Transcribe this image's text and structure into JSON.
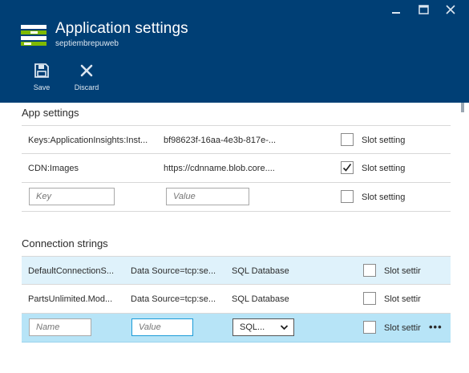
{
  "window": {
    "title": "Application settings",
    "subtitle": "septiembrepuweb",
    "controls": [
      "minimize-icon",
      "maximize-icon",
      "close-icon"
    ]
  },
  "toolbar": {
    "save_label": "Save",
    "discard_label": "Discard"
  },
  "app_settings": {
    "title": "App settings",
    "rows": [
      {
        "key": "Keys:ApplicationInsights:Inst...",
        "value": "bf98623f-16aa-4e3b-817e-...",
        "slot_label": "Slot setting",
        "checked": false
      },
      {
        "key": "CDN:Images",
        "value": "https://cdnname.blob.core....",
        "slot_label": "Slot setting",
        "checked": true
      }
    ],
    "new_row": {
      "key_placeholder": "Key",
      "value_placeholder": "Value",
      "slot_label": "Slot setting",
      "checked": false
    }
  },
  "connection_strings": {
    "title": "Connection strings",
    "rows": [
      {
        "name": "DefaultConnectionS...",
        "value": "Data Source=tcp:se...",
        "type": "SQL Database",
        "slot_label": "Slot settir",
        "checked": false
      },
      {
        "name": "PartsUnlimited.Mod...",
        "value": "Data Source=tcp:se...",
        "type": "SQL Database",
        "slot_label": "Slot settir",
        "checked": false
      }
    ],
    "new_row": {
      "name_placeholder": "Name",
      "value_placeholder": "Value",
      "type_selected": "SQL...",
      "slot_label": "Slot settir",
      "checked": false,
      "more": "•••"
    }
  },
  "colors": {
    "header_bg": "#003f75",
    "selected_row": "#dff2fb",
    "active_row": "#b7e4f7"
  }
}
